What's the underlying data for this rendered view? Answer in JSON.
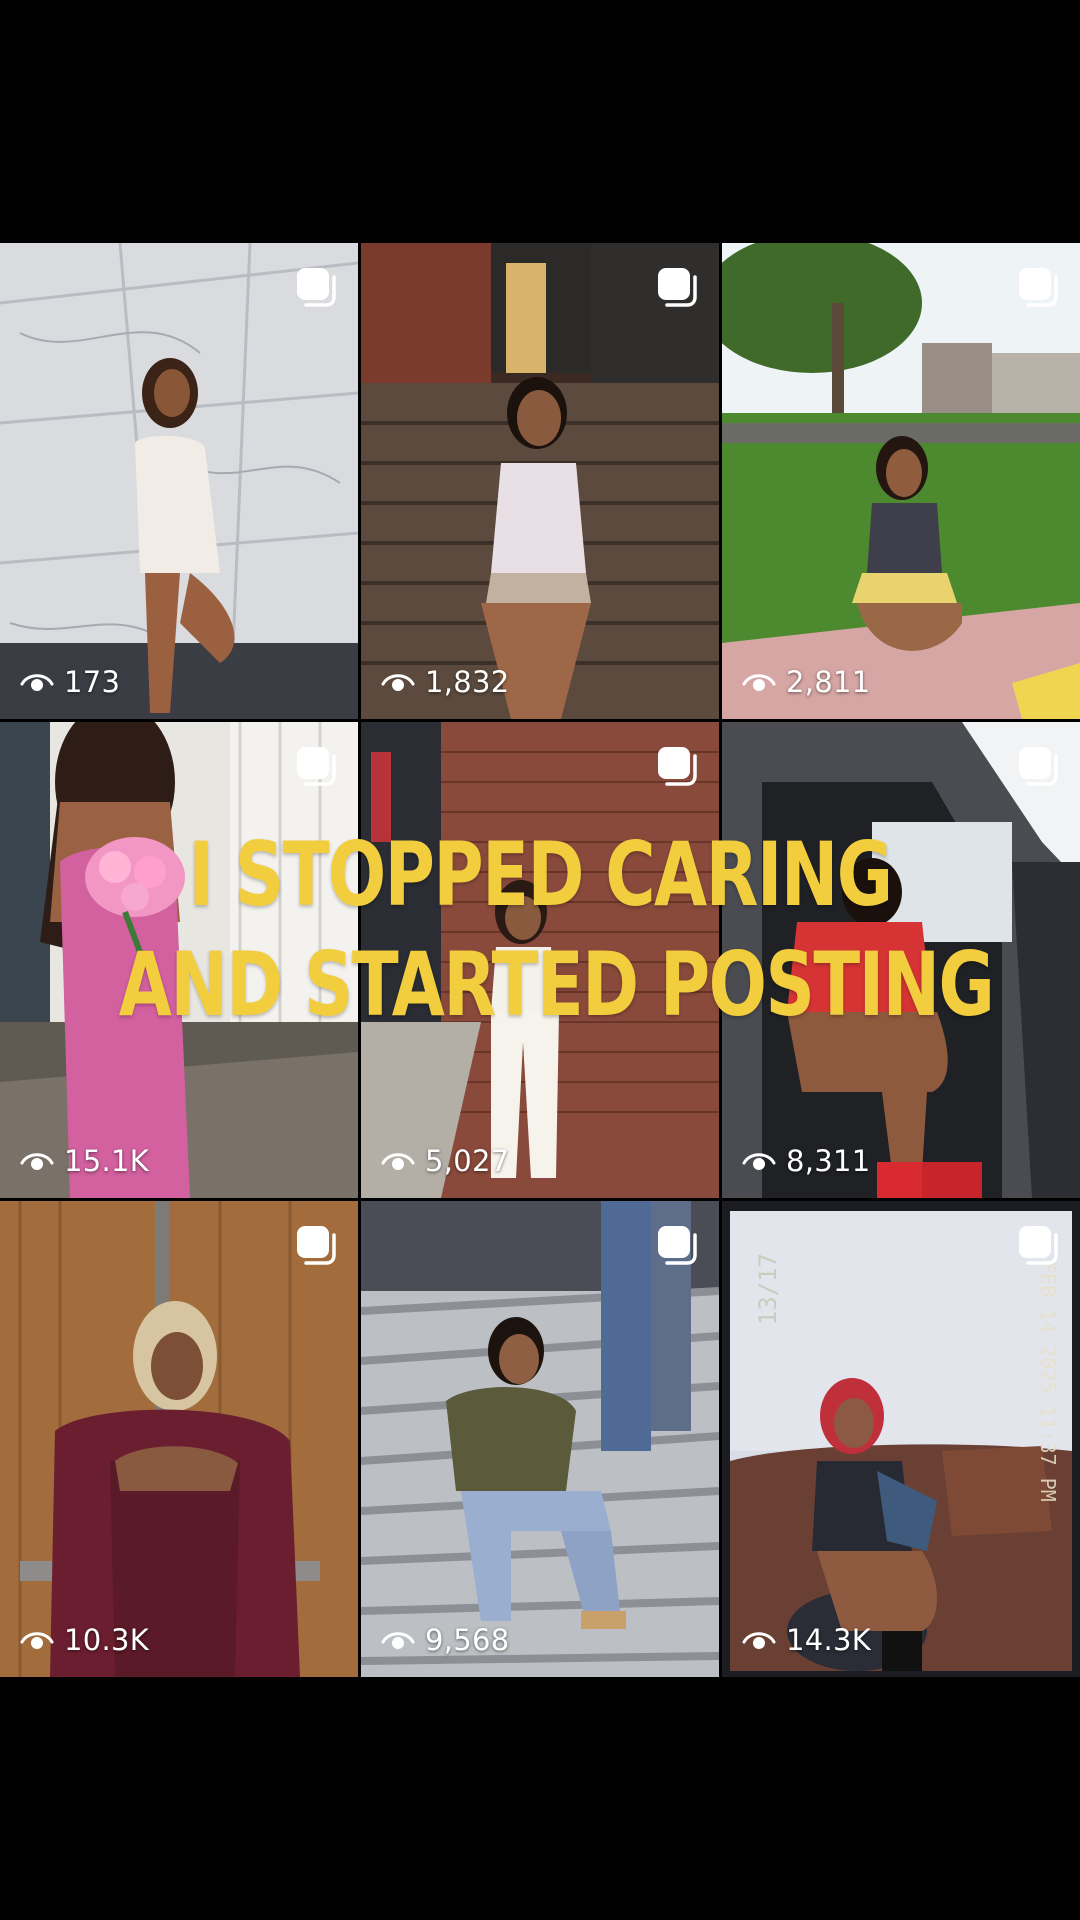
{
  "overlay": {
    "line1": "I STOPPED CARING",
    "line2": "AND STARTED POSTING",
    "color": "#f2cd3e"
  },
  "grid": {
    "tiles": [
      {
        "views": "173",
        "icon": "multiple-photos-icon",
        "view_icon": "eye-icon"
      },
      {
        "views": "1,832",
        "icon": "multiple-photos-icon",
        "view_icon": "eye-icon"
      },
      {
        "views": "2,811",
        "icon": "multiple-photos-icon",
        "view_icon": "eye-icon"
      },
      {
        "views": "15.1K",
        "icon": "multiple-photos-icon",
        "view_icon": "eye-icon"
      },
      {
        "views": "5,027",
        "icon": "multiple-photos-icon",
        "view_icon": "eye-icon"
      },
      {
        "views": "8,311",
        "icon": "multiple-photos-icon",
        "view_icon": "eye-icon"
      },
      {
        "views": "10.3K",
        "icon": "multiple-photos-icon",
        "view_icon": "eye-icon"
      },
      {
        "views": "9,568",
        "icon": "multiple-photos-icon",
        "view_icon": "eye-icon"
      },
      {
        "views": "14.3K",
        "icon": "multiple-photos-icon",
        "view_icon": "eye-icon",
        "photo_stamp_frame": "13/17",
        "photo_stamp_date": "FEB 14 2025 11:37 PM"
      }
    ]
  }
}
